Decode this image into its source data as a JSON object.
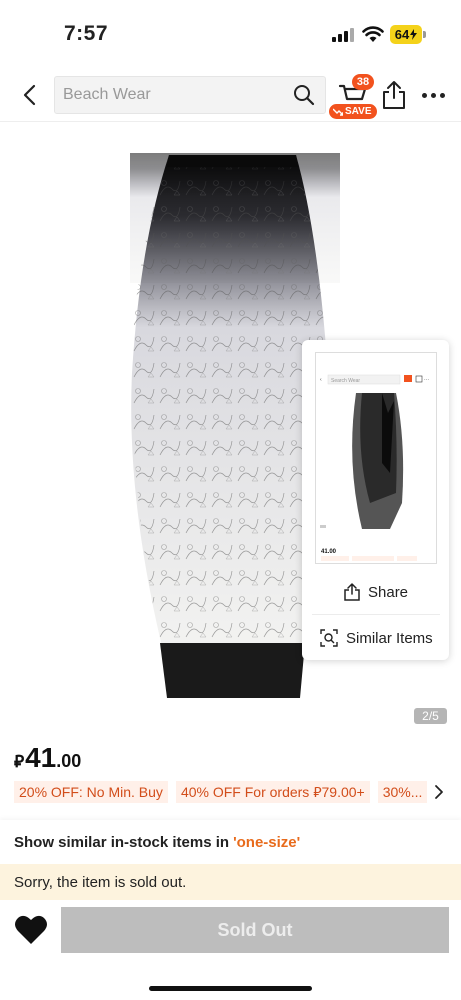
{
  "status_bar": {
    "time": "7:57",
    "battery": "64"
  },
  "header": {
    "search_placeholder": "Beach Wear",
    "cart_count": "38",
    "save_label": "SAVE"
  },
  "gallery": {
    "counter": "2/5"
  },
  "screenshot_popup": {
    "share_label": "Share",
    "similar_label": "Similar Items",
    "thumb": {
      "search_placeholder": "Search Wear",
      "price": "41.00"
    }
  },
  "price": {
    "currency_symbol": "⃁",
    "integer": "41",
    "decimal": ".00"
  },
  "promotions": [
    "20% OFF: No Min. Buy",
    "40% OFF For orders ⃁79.00+",
    "30%..."
  ],
  "similar_stock": {
    "text": "Show similar in-stock items in",
    "size": "'one-size'"
  },
  "notice": "Sorry, the item is sold out.",
  "bottom_bar": {
    "sold_out_label": "Sold Out"
  },
  "colors": {
    "accent": "#f2521e",
    "promo_text": "#d24d1a",
    "promo_bg": "#fff0e9",
    "notice_bg": "#fdf3de",
    "disabled_button": "#bdbdbd"
  }
}
